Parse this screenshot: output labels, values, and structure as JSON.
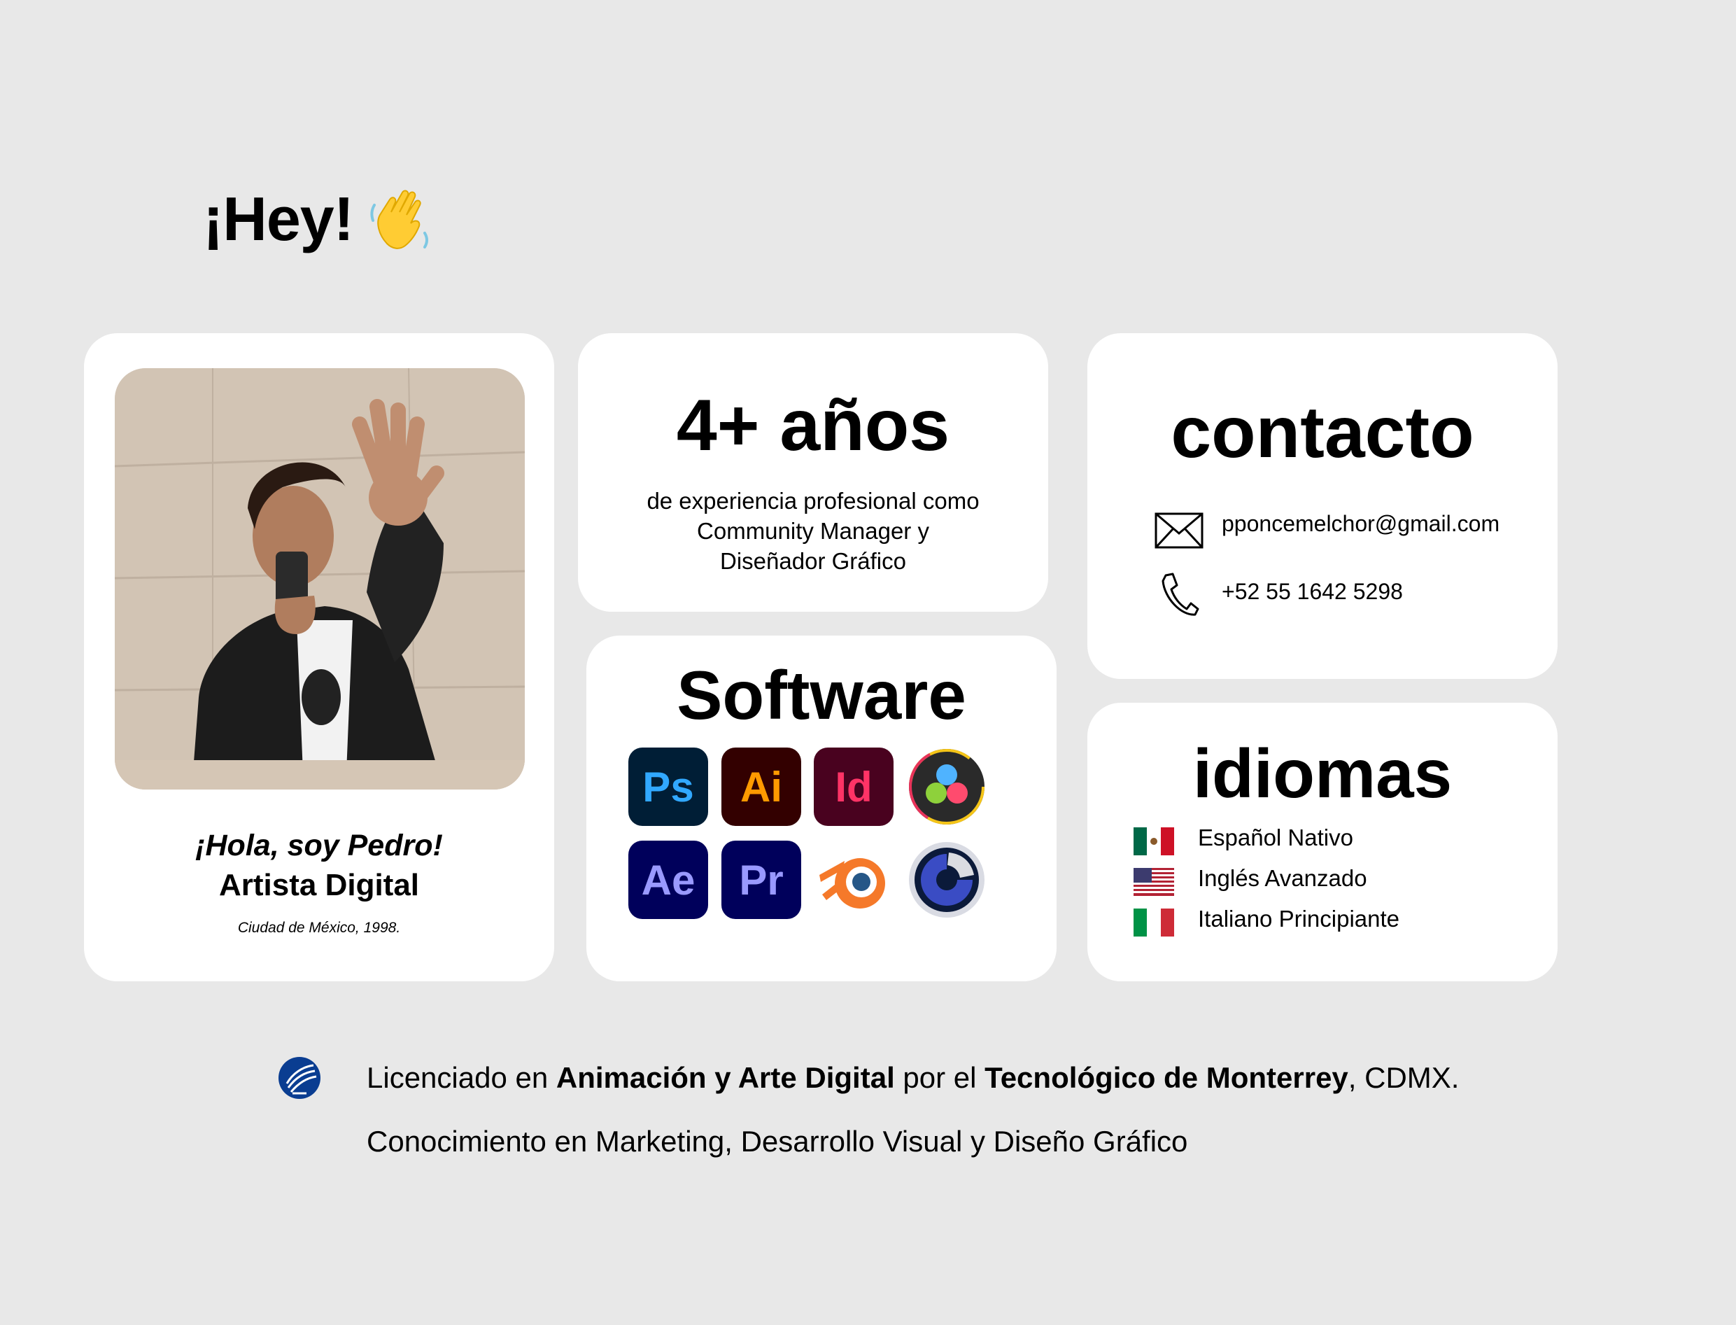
{
  "header": {
    "greeting": "¡Hey!",
    "emoji": "waving-hand"
  },
  "profile": {
    "greeting": "¡Hola, soy Pedro!",
    "role": "Artista Digital",
    "origin": "Ciudad de México, 1998."
  },
  "experience": {
    "years": "4+ años",
    "line1": "de experiencia profesional como",
    "line2": "Community Manager y",
    "line3": "Diseñador Gráfico"
  },
  "software": {
    "title": "Software",
    "apps": [
      {
        "label": "Ps",
        "icon": "photoshop-icon",
        "bg": "#001e36",
        "fg": "#31a8ff"
      },
      {
        "label": "Ai",
        "icon": "illustrator-icon",
        "bg": "#330000",
        "fg": "#ff9a00"
      },
      {
        "label": "Id",
        "icon": "indesign-icon",
        "bg": "#49021f",
        "fg": "#ff3366"
      },
      {
        "label": "",
        "icon": "davinci-resolve-icon"
      },
      {
        "label": "Ae",
        "icon": "after-effects-icon",
        "bg": "#00005b",
        "fg": "#9999ff"
      },
      {
        "label": "Pr",
        "icon": "premiere-icon",
        "bg": "#00005b",
        "fg": "#9999ff"
      },
      {
        "label": "",
        "icon": "blender-icon"
      },
      {
        "label": "",
        "icon": "cinema4d-icon"
      }
    ]
  },
  "contact": {
    "title": "contacto",
    "email": "pponcemelchor@gmail.com",
    "phone": "+52 55 1642 5298"
  },
  "languages": {
    "title": "idiomas",
    "items": [
      {
        "label": "Español Nativo",
        "flag": "mexico-flag"
      },
      {
        "label": "Inglés Avanzado",
        "flag": "usa-flag"
      },
      {
        "label": "Italiano Principiante",
        "flag": "italy-flag"
      }
    ]
  },
  "education": {
    "prefix": "Licenciado en ",
    "degree": "Animación y Arte Digital",
    "middle": " por el ",
    "school": "Tecnológico de Monterrey",
    "suffix": ", CDMX.",
    "skills": "Conocimiento en Marketing, Desarrollo Visual y Diseño Gráfico"
  },
  "colors": {
    "background": "#e8e8e8",
    "card": "#ffffff",
    "tec_blue": "#0a3d91"
  }
}
